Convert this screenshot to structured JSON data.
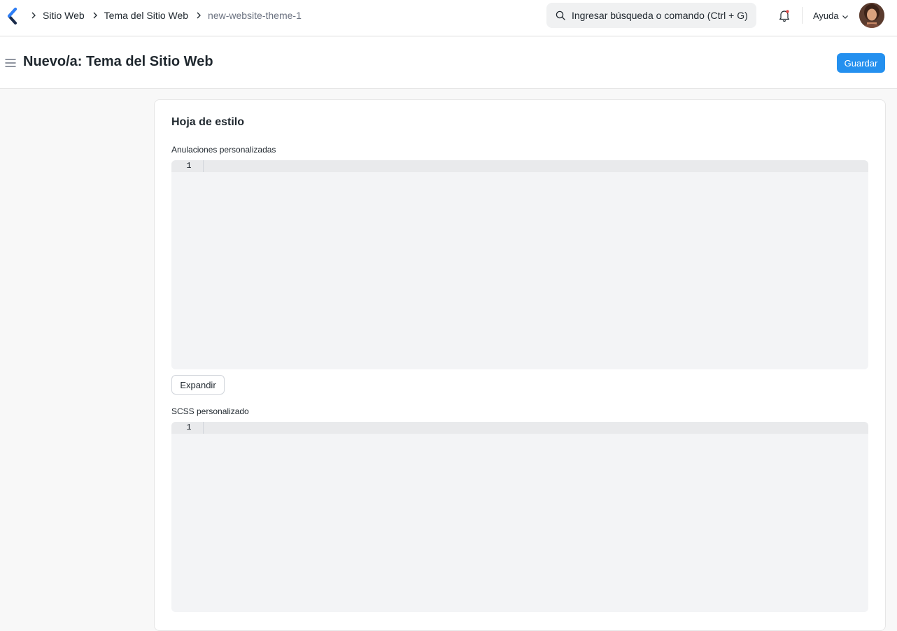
{
  "navbar": {
    "breadcrumbs": [
      "Sitio Web",
      "Tema del Sitio Web",
      "new-website-theme-1"
    ],
    "search_placeholder": "Ingresar búsqueda o comando (Ctrl + G)",
    "help_label": "Ayuda",
    "icons": [
      "app-logo-icon",
      "chevron-right-icon",
      "search-icon",
      "bell-icon",
      "chevron-down-icon"
    ]
  },
  "page_head": {
    "title": "Nuevo/a: Tema del Sitio Web",
    "save_label": "Guardar"
  },
  "form": {
    "section_title": "Hoja de estilo",
    "fields": [
      {
        "label": "Anulaciones personalizadas",
        "line_number": "1"
      },
      {
        "label": "SCSS personalizado",
        "line_number": "1"
      }
    ],
    "expand_label": "Expandir"
  },
  "colors": {
    "primary": "#2490ef",
    "editor_bg": "#f3f4f6",
    "notification_dot": "#e24c4c"
  }
}
